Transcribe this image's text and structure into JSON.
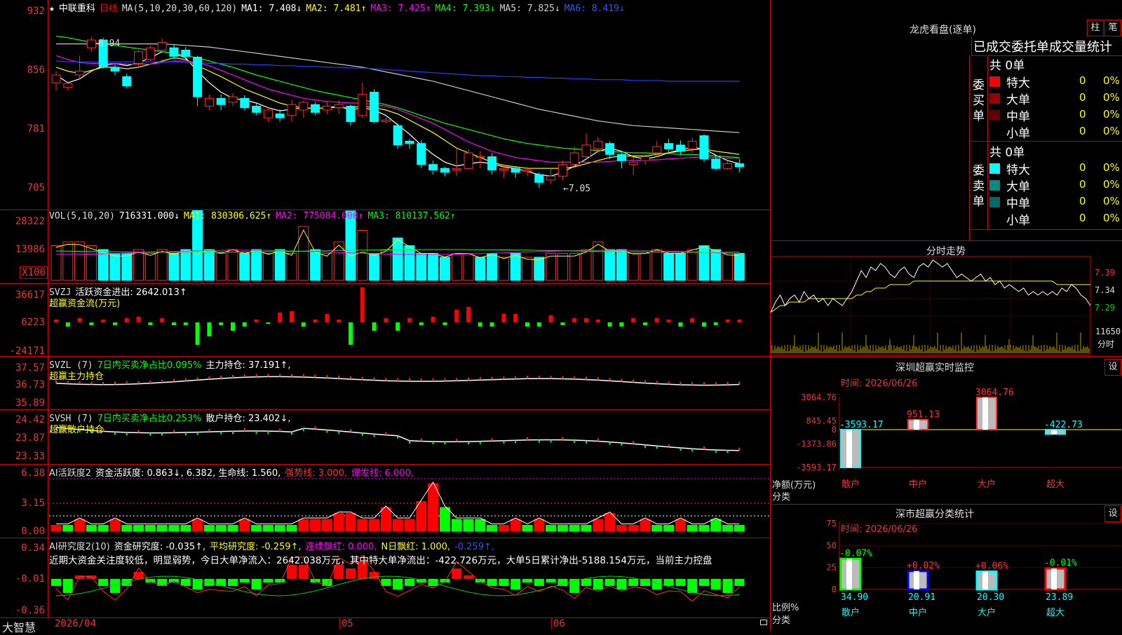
{
  "kline": {
    "stock": "中联重科",
    "period": "日线",
    "ma_spec": "MA(5,10,20,30,60,120)",
    "ma": [
      {
        "label": "MA1: 7.408↓",
        "color": "#ffffff"
      },
      {
        "label": "MA2: 7.481↑",
        "color": "#ffff00"
      },
      {
        "label": "MA3: 7.425↑",
        "color": "#ff00ff"
      },
      {
        "label": "MA4: 7.393↓",
        "color": "#00ff00"
      },
      {
        "label": "MA5: 7.825↓",
        "color": "#d0d0d0"
      },
      {
        "label": "MA6: 8.419↓",
        "color": "#3355ff"
      }
    ],
    "y_labels": [
      "932",
      "856",
      "781",
      "705"
    ],
    "y_range": [
      6.9,
      9.35
    ],
    "high_label": "8.94",
    "low_label": "←7.05",
    "candles": [
      [
        8.4,
        8.5,
        8.3,
        8.55
      ],
      [
        8.34,
        8.39,
        8.3,
        8.42
      ],
      [
        8.5,
        8.55,
        8.45,
        8.75
      ],
      [
        8.85,
        8.95,
        8.8,
        8.99
      ],
      [
        8.95,
        8.61,
        8.58,
        8.98
      ],
      [
        8.6,
        8.55,
        8.5,
        8.65
      ],
      [
        8.48,
        8.36,
        8.33,
        8.52
      ],
      [
        8.65,
        8.8,
        8.6,
        8.83
      ],
      [
        8.7,
        8.85,
        8.68,
        8.88
      ],
      [
        8.82,
        8.92,
        8.78,
        8.97
      ],
      [
        8.85,
        8.74,
        8.7,
        8.9
      ],
      [
        8.82,
        8.74,
        8.7,
        8.86
      ],
      [
        8.73,
        8.22,
        8.1,
        8.75
      ],
      [
        8.1,
        8.2,
        8.05,
        8.25
      ],
      [
        8.2,
        8.12,
        8.05,
        8.25
      ],
      [
        8.15,
        8.22,
        8.1,
        8.27
      ],
      [
        8.2,
        8.08,
        8.05,
        8.24
      ],
      [
        8.1,
        8.02,
        7.98,
        8.15
      ],
      [
        7.95,
        8.05,
        7.9,
        8.08
      ],
      [
        8.0,
        7.95,
        7.9,
        8.06
      ],
      [
        7.98,
        8.12,
        7.9,
        8.18
      ],
      [
        8.05,
        8.15,
        7.95,
        8.17
      ],
      [
        8.12,
        8.02,
        7.98,
        8.15
      ],
      [
        8.05,
        8.1,
        8.0,
        8.15
      ],
      [
        8.08,
        8.12,
        8.0,
        8.18
      ],
      [
        8.1,
        7.9,
        7.85,
        8.12
      ],
      [
        7.98,
        8.25,
        7.95,
        8.4
      ],
      [
        8.28,
        7.9,
        7.88,
        8.32
      ],
      [
        7.9,
        7.92,
        7.88,
        7.96
      ],
      [
        7.85,
        7.6,
        7.55,
        7.88
      ],
      [
        7.65,
        7.62,
        7.55,
        7.68
      ],
      [
        7.62,
        7.35,
        7.3,
        7.66
      ],
      [
        7.35,
        7.28,
        7.22,
        7.4
      ],
      [
        7.3,
        7.25,
        7.2,
        7.32
      ],
      [
        7.28,
        7.3,
        7.2,
        7.55
      ],
      [
        7.3,
        7.5,
        7.28,
        7.55
      ],
      [
        7.45,
        7.45,
        7.3,
        7.52
      ],
      [
        7.45,
        7.28,
        7.22,
        7.5
      ],
      [
        7.28,
        7.3,
        7.18,
        7.36
      ],
      [
        7.3,
        7.25,
        7.18,
        7.33
      ],
      [
        7.26,
        7.28,
        7.2,
        7.32
      ],
      [
        7.22,
        7.12,
        7.05,
        7.25
      ],
      [
        7.15,
        7.2,
        7.1,
        7.3
      ],
      [
        7.2,
        7.35,
        7.15,
        7.4
      ],
      [
        7.35,
        7.5,
        7.3,
        7.58
      ],
      [
        7.45,
        7.6,
        7.42,
        7.75
      ],
      [
        7.55,
        7.65,
        7.5,
        7.7
      ],
      [
        7.62,
        7.48,
        7.42,
        7.65
      ],
      [
        7.48,
        7.4,
        7.3,
        7.5
      ],
      [
        7.35,
        7.38,
        7.22,
        7.45
      ],
      [
        7.4,
        7.45,
        7.35,
        7.48
      ],
      [
        7.5,
        7.58,
        7.45,
        7.65
      ],
      [
        7.62,
        7.55,
        7.5,
        7.68
      ],
      [
        7.6,
        7.52,
        7.48,
        7.66
      ],
      [
        7.55,
        7.65,
        7.5,
        7.7
      ],
      [
        7.72,
        7.42,
        7.38,
        7.74
      ],
      [
        7.42,
        7.3,
        7.28,
        7.46
      ],
      [
        7.3,
        7.36,
        7.28,
        7.4
      ],
      [
        7.36,
        7.32,
        7.25,
        7.42
      ]
    ],
    "lines": {
      "ma1": [
        8.5,
        8.4,
        8.45,
        8.55,
        8.62,
        8.65,
        8.62,
        8.66,
        8.72,
        8.8,
        8.78,
        8.72,
        8.55,
        8.4,
        8.28,
        8.2,
        8.18,
        8.14,
        8.08,
        8.04,
        8.06,
        8.08,
        8.07,
        8.08,
        8.1,
        8.05,
        8.08,
        8.05,
        7.98,
        7.86,
        7.74,
        7.6,
        7.48,
        7.38,
        7.33,
        7.36,
        7.38,
        7.36,
        7.32,
        7.3,
        7.26,
        7.22,
        7.2,
        7.25,
        7.33,
        7.42,
        7.52,
        7.56,
        7.52,
        7.45,
        7.42,
        7.45,
        7.5,
        7.54,
        7.57,
        7.55,
        7.47,
        7.4,
        7.36
      ],
      "ma2": [
        8.6,
        8.55,
        8.52,
        8.56,
        8.6,
        8.6,
        8.58,
        8.6,
        8.64,
        8.68,
        8.72,
        8.7,
        8.62,
        8.55,
        8.48,
        8.4,
        8.32,
        8.26,
        8.2,
        8.14,
        8.1,
        8.08,
        8.07,
        8.08,
        8.08,
        8.08,
        8.1,
        8.08,
        8.05,
        8.0,
        7.92,
        7.84,
        7.76,
        7.66,
        7.56,
        7.5,
        7.44,
        7.38,
        7.34,
        7.32,
        7.3,
        7.3,
        7.3,
        7.3,
        7.32,
        7.36,
        7.4,
        7.44,
        7.46,
        7.46,
        7.46,
        7.48,
        7.5,
        7.52,
        7.54,
        7.55,
        7.52,
        7.5,
        7.48
      ],
      "ma3": [
        8.75,
        8.7,
        8.66,
        8.65,
        8.65,
        8.65,
        8.64,
        8.64,
        8.64,
        8.66,
        8.68,
        8.68,
        8.66,
        8.62,
        8.56,
        8.5,
        8.44,
        8.38,
        8.32,
        8.28,
        8.24,
        8.2,
        8.18,
        8.16,
        8.15,
        8.14,
        8.14,
        8.12,
        8.1,
        8.06,
        8.0,
        7.94,
        7.88,
        7.8,
        7.72,
        7.64,
        7.58,
        7.52,
        7.48,
        7.44,
        7.42,
        7.4,
        7.38,
        7.38,
        7.38,
        7.38,
        7.38,
        7.39,
        7.4,
        7.4,
        7.41,
        7.41,
        7.42,
        7.43,
        7.44,
        7.45,
        7.44,
        7.43,
        7.43
      ],
      "ma4": [
        9.0,
        8.98,
        8.95,
        8.92,
        8.9,
        8.88,
        8.86,
        8.84,
        8.82,
        8.8,
        8.78,
        8.75,
        8.72,
        8.68,
        8.64,
        8.6,
        8.55,
        8.5,
        8.46,
        8.42,
        8.38,
        8.34,
        8.3,
        8.27,
        8.24,
        8.21,
        8.18,
        8.15,
        8.12,
        8.08,
        8.03,
        7.98,
        7.93,
        7.88,
        7.84,
        7.8,
        7.76,
        7.72,
        7.68,
        7.65,
        7.62,
        7.6,
        7.58,
        7.56,
        7.55,
        7.54,
        7.53,
        7.52,
        7.51,
        7.5,
        7.5,
        7.49,
        7.49,
        7.48,
        7.48,
        7.47,
        7.46,
        7.45,
        7.44
      ],
      "ma5": [
        8.9,
        8.9,
        8.9,
        8.9,
        8.9,
        8.9,
        8.9,
        8.9,
        8.9,
        8.9,
        8.89,
        8.88,
        8.87,
        8.86,
        8.84,
        8.82,
        8.8,
        8.78,
        8.76,
        8.74,
        8.72,
        8.7,
        8.68,
        8.66,
        8.64,
        8.62,
        8.6,
        8.57,
        8.54,
        8.51,
        8.48,
        8.45,
        8.42,
        8.38,
        8.34,
        8.3,
        8.26,
        8.22,
        8.18,
        8.14,
        8.1,
        8.06,
        8.03,
        8.0,
        7.97,
        7.94,
        7.91,
        7.89,
        7.87,
        7.85,
        7.84,
        7.83,
        7.82,
        7.81,
        7.8,
        7.79,
        7.78,
        7.77,
        7.76
      ],
      "ma6": [
        8.68,
        8.67,
        8.67,
        8.67,
        8.67,
        8.67,
        8.67,
        8.67,
        8.67,
        8.67,
        8.67,
        8.66,
        8.66,
        8.65,
        8.65,
        8.64,
        8.64,
        8.63,
        8.63,
        8.62,
        8.62,
        8.61,
        8.61,
        8.6,
        8.6,
        8.59,
        8.59,
        8.58,
        8.57,
        8.56,
        8.55,
        8.54,
        8.53,
        8.52,
        8.51,
        8.5,
        8.49,
        8.49,
        8.48,
        8.48,
        8.47,
        8.47,
        8.46,
        8.46,
        8.45,
        8.45,
        8.44,
        8.44,
        8.44,
        8.43,
        8.43,
        8.43,
        8.42,
        8.42,
        8.42,
        8.42,
        8.42,
        8.42,
        8.42
      ]
    }
  },
  "vol": {
    "title": "VOL(5,10,20)",
    "items": [
      {
        "label": "716331.000↓",
        "color": "#ffffff"
      },
      {
        "label": "MA1: 830306.625↑",
        "color": "#ffff00"
      },
      {
        "label": "MA2: 775084.000↑",
        "color": "#ff00ff"
      },
      {
        "label": "MA3: 810137.562↑",
        "color": "#00ff00"
      }
    ],
    "y_labels": [
      "28322",
      "13986"
    ],
    "unit": "X100",
    "values": [
      9,
      10,
      10,
      9,
      8,
      7,
      7,
      8,
      7,
      8,
      7,
      8,
      7,
      8,
      7,
      8,
      7,
      8,
      7,
      8,
      7,
      14,
      8,
      7,
      10,
      7,
      8,
      7,
      8,
      11,
      9,
      7,
      7,
      6,
      7,
      7,
      6,
      7,
      6,
      7,
      6,
      6,
      7,
      7,
      7,
      8,
      10,
      8,
      8,
      7,
      7,
      8,
      7,
      7,
      8,
      9,
      8,
      7,
      7
    ],
    "up": [
      1,
      1,
      1,
      1,
      0,
      0,
      0,
      1,
      1,
      1,
      0,
      0,
      0,
      0,
      1,
      1,
      0,
      0,
      1,
      0,
      1,
      1,
      0,
      1,
      1,
      0,
      1,
      0,
      1,
      0,
      0,
      0,
      0,
      0,
      1,
      1,
      0,
      0,
      1,
      0,
      1,
      0,
      1,
      1,
      1,
      1,
      1,
      0,
      0,
      1,
      1,
      1,
      0,
      0,
      1,
      0,
      0,
      1,
      0
    ],
    "big": [
      [
        12,
        20
      ],
      [
        25,
        18
      ],
      [
        26,
        13
      ]
    ]
  },
  "svzj": {
    "title": "SVZJ",
    "desc": "活跃资金进出: 2642.013↑",
    "sub": "超赢资金流(万元)",
    "y_labels": [
      "36617",
      "6223",
      "-24171"
    ],
    "values": [
      2,
      -3,
      3,
      -2,
      2,
      -2,
      3,
      4,
      -2,
      3,
      -2,
      -2,
      -16,
      -10,
      -2,
      -6,
      -3,
      2,
      -1,
      7,
      8,
      -3,
      2,
      6,
      2,
      -16,
      25,
      -6,
      3,
      -6,
      3,
      -2,
      4,
      -2,
      9,
      11,
      -3,
      -3,
      6,
      6,
      -3,
      -3,
      5,
      -2,
      3,
      3,
      2,
      -3,
      -3,
      3,
      -2,
      3,
      2,
      -3,
      3,
      -3,
      -2,
      2,
      2
    ]
  },
  "svzl": {
    "title": "SVZL (7)",
    "desc_green": "7日内买卖净占比0.095%",
    "desc2": "主力持仓: 37.191↑,",
    "sub": "超赢主力持仓",
    "y_labels": [
      "37.57",
      "36.73",
      "35.89"
    ]
  },
  "svsh": {
    "title": "SVSH (7)",
    "desc_green": "7日内买卖净占比0.253%",
    "desc2": "散户持仓: 23.402↓,",
    "sub": "超赢散户持仓",
    "y_labels": [
      "24.42",
      "23.87",
      "23.33"
    ]
  },
  "ai1": {
    "title": "AI活跃度2",
    "desc": "资金活跃度: 0.863↓, 6.382, 生命线: 1.560,",
    "strong": "强势线: 3.000,",
    "burst": "爆发线: 6.000,",
    "y_labels": [
      "6.38",
      "3.15",
      "0.00"
    ],
    "values": [
      1,
      1,
      2,
      1,
      1,
      2,
      1,
      1,
      1,
      1,
      1,
      1,
      2,
      1,
      1,
      1,
      2,
      1,
      1,
      1,
      1,
      2,
      2,
      2,
      3,
      3,
      2,
      2,
      4,
      2,
      2,
      5,
      8,
      4,
      2,
      2,
      2,
      1,
      1,
      2,
      1,
      2,
      1,
      1,
      1,
      1,
      2,
      3,
      1,
      1,
      2,
      1,
      1,
      2,
      1,
      1,
      2,
      1,
      1
    ],
    "up": [
      1,
      0,
      1,
      0,
      0,
      1,
      0,
      0,
      0,
      0,
      0,
      0,
      1,
      0,
      0,
      0,
      1,
      0,
      0,
      0,
      0,
      1,
      1,
      1,
      1,
      1,
      1,
      1,
      1,
      1,
      1,
      1,
      1,
      0,
      0,
      0,
      0,
      0,
      1,
      1,
      0,
      1,
      0,
      0,
      0,
      0,
      1,
      1,
      1,
      1,
      1,
      0,
      0,
      1,
      0,
      0,
      0,
      0,
      0
    ]
  },
  "ai2": {
    "title": "AI研究度2(10)",
    "desc": "资金研究度: -0.035↑,",
    "avg": "平均研究度: -0.259↑,",
    "red": "连续飘红: 0.000,",
    "nday": "N日飘红: 1.000,",
    "nval": "-0.259↑,",
    "text": "近期大资金关注度较低，明显弱势，今日大单净流入：2642.038万元，其中特大单净流出：-422.726万元，大单5日累计净出-5188.154万元，当前主力控盘",
    "y_labels": [
      "0.34",
      "-0.01",
      "-0.36"
    ],
    "values": [
      -2,
      -4,
      1,
      1,
      -2,
      -4,
      -2,
      2,
      -1,
      -2,
      -1,
      -2,
      -3,
      -2,
      -2,
      -2,
      -1,
      -3,
      -1,
      -1,
      4,
      4,
      -1,
      -2,
      4,
      3,
      5,
      2,
      -2,
      -3,
      -2,
      -1,
      -2,
      -1,
      3,
      1,
      -1,
      -2,
      -2,
      -3,
      -1,
      -2,
      -1,
      -2,
      -4,
      -2,
      -3,
      -2,
      -3,
      -2,
      -2,
      -3,
      -2,
      -2,
      -4,
      -2,
      -3,
      -4,
      -2
    ]
  },
  "xaxis": {
    "date1": "2026/04",
    "m1": "05",
    "m2": "06",
    "brand": "大智慧"
  },
  "lhb": {
    "title": "龙虎看盘(逐单)",
    "btn1": "柱",
    "btn2": "笔",
    "tabs": "已成交委托单成交量统计",
    "buy_label": "委买单",
    "sell_label": "委卖单",
    "buy_total": "共 0单",
    "sell_total": "共 0单",
    "buy_rows": [
      {
        "name": "特大",
        "qty": "0",
        "pct": "0%",
        "color": "#ff0000"
      },
      {
        "name": "大单",
        "qty": "0",
        "pct": "0%",
        "color": "#990000"
      },
      {
        "name": "中单",
        "qty": "0",
        "pct": "0%",
        "color": "#660000"
      },
      {
        "name": "小单",
        "qty": "0",
        "pct": "0%",
        "color": ""
      }
    ],
    "sell_rows": [
      {
        "name": "特大",
        "qty": "0",
        "pct": "0%",
        "color": "#00ffff"
      },
      {
        "name": "大单",
        "qty": "0",
        "pct": "0%",
        "color": "#008b8b"
      },
      {
        "name": "中单",
        "qty": "0",
        "pct": "0%",
        "color": "#006a6a"
      },
      {
        "name": "小单",
        "qty": "0",
        "pct": "0%",
        "color": ""
      }
    ]
  },
  "fenshi": {
    "title": "分时走势",
    "y_labels": [
      "7.39",
      "7.34",
      "7.29"
    ],
    "vol_label": "11650",
    "vol_unit": "分时",
    "price": [
      7.28,
      7.31,
      7.33,
      7.3,
      7.32,
      7.33,
      7.31,
      7.34,
      7.32,
      7.33,
      7.31,
      7.32,
      7.3,
      7.32,
      7.31,
      7.3,
      7.32,
      7.34,
      7.37,
      7.4,
      7.38,
      7.41,
      7.4,
      7.42,
      7.41,
      7.39,
      7.38,
      7.4,
      7.41,
      7.39,
      7.38,
      7.41,
      7.42,
      7.41,
      7.43,
      7.42,
      7.41,
      7.42,
      7.4,
      7.38,
      7.39,
      7.38,
      7.37,
      7.38,
      7.39,
      7.37,
      7.38,
      7.36,
      7.37,
      7.35,
      7.36,
      7.35,
      7.34,
      7.35,
      7.33,
      7.34,
      7.33,
      7.34,
      7.33,
      7.34,
      7.33,
      7.35,
      7.34,
      7.36,
      7.35,
      7.33,
      7.32,
      7.3
    ],
    "avg": [
      7.28,
      7.29,
      7.3,
      7.3,
      7.31,
      7.31,
      7.31,
      7.31,
      7.32,
      7.32,
      7.32,
      7.32,
      7.32,
      7.32,
      7.32,
      7.32,
      7.32,
      7.32,
      7.33,
      7.33,
      7.34,
      7.34,
      7.35,
      7.35,
      7.35,
      7.36,
      7.36,
      7.36,
      7.36,
      7.36,
      7.37,
      7.37,
      7.37,
      7.37,
      7.37,
      7.37,
      7.37,
      7.37,
      7.37,
      7.37,
      7.37,
      7.37,
      7.37,
      7.37,
      7.37,
      7.37,
      7.37,
      7.37,
      7.37,
      7.37,
      7.37,
      7.37,
      7.37,
      7.37,
      7.37,
      7.37,
      7.37,
      7.37,
      7.37,
      7.37,
      7.36,
      7.36,
      7.36,
      7.36,
      7.36,
      7.36,
      7.36,
      7.36
    ]
  },
  "szjk": {
    "title": "深圳超赢实时监控",
    "btn": "设",
    "time": "时间: 2026/06/26",
    "y_labels": [
      "3064.76",
      "845.45",
      "0",
      "-1373.86",
      "-3593.17"
    ],
    "ylabel1": "净额(万元)",
    "ylabel2": "分类",
    "chart_data": {
      "type": "bar",
      "categories": [
        "散户",
        "中户",
        "大户",
        "超大"
      ],
      "values": [
        -3593.17,
        951.13,
        3064.76,
        -422.73
      ],
      "value_labels": [
        "-3593.17",
        "951.13",
        "3064.76",
        "-422.73"
      ],
      "ylim": [
        -3593.17,
        3064.76
      ]
    }
  },
  "sstj": {
    "title": "深市超赢分类统计",
    "btn": "设",
    "time": "时间: 2026/06/26",
    "y_labels": [
      "75",
      "50",
      "25",
      "0"
    ],
    "ylabel1": "比例%",
    "ylabel2": "分类",
    "chart_data": {
      "type": "bar",
      "categories": [
        "散户",
        "中户",
        "大户",
        "超大"
      ],
      "values": [
        34.9,
        20.91,
        20.3,
        23.89
      ],
      "changes": [
        "-0.07%",
        "+0.02%",
        "+0.06%",
        "-0.01%"
      ],
      "values_text": [
        "34.90",
        "20.91",
        "20.30",
        "23.89"
      ],
      "ylim": [
        0,
        75
      ],
      "colors": [
        "#00ff00",
        "#0000ff",
        "#00ffff",
        "#ff0000"
      ]
    }
  }
}
